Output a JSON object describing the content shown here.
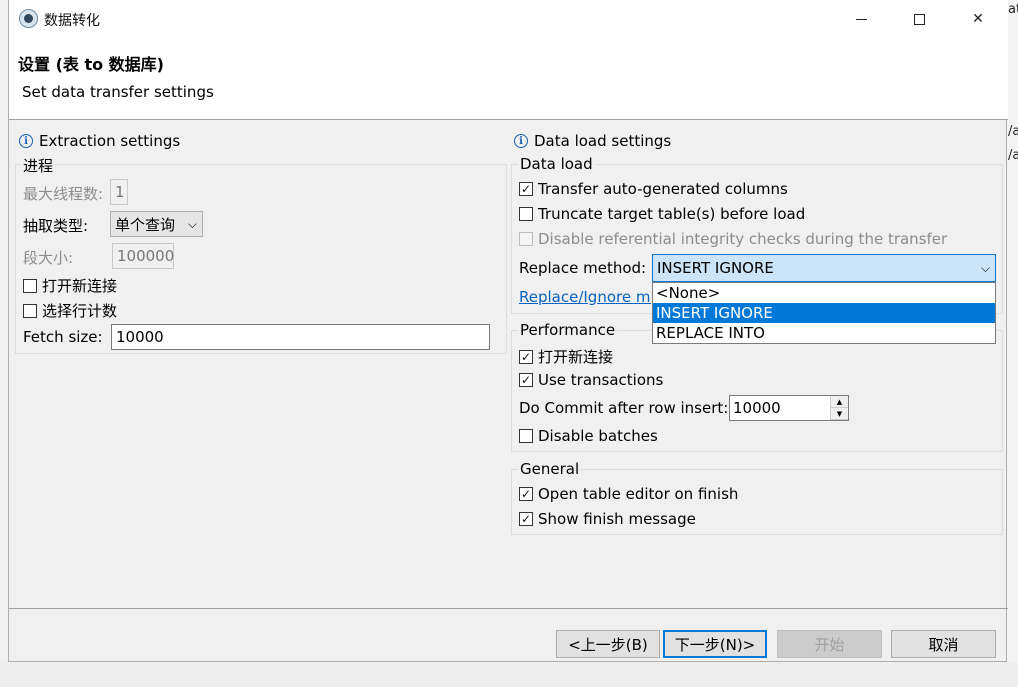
{
  "window": {
    "title": "数据转化",
    "minimize_icon": "minimize-icon",
    "maximize_icon": "maximize-icon",
    "close_glyph": "✕"
  },
  "background": {
    "right_text_1": "at",
    "right_text_2": "/a",
    "right_text_3": "/a"
  },
  "header": {
    "title": "设置 (表 to 数据库)",
    "subtitle": "Set data transfer settings"
  },
  "extraction": {
    "title": "Extraction settings",
    "group_label": "进程",
    "max_threads_label": "最大线程数:",
    "max_threads_value": "1",
    "extract_type_label": "抽取类型:",
    "extract_type_value": "单个查询",
    "segment_size_label": "段大小:",
    "segment_size_value": "100000",
    "open_new_connection": {
      "label": "打开新连接",
      "checked": false
    },
    "select_row_count": {
      "label": "选择行计数",
      "checked": false
    },
    "fetch_size_label": "Fetch size:",
    "fetch_size_value": "10000"
  },
  "data_load": {
    "title": "Data load settings",
    "group_label": "Data load",
    "transfer_auto_generated": {
      "label": "Transfer auto-generated columns",
      "checked": true
    },
    "truncate_target": {
      "label": "Truncate target table(s) before load",
      "checked": false
    },
    "disable_ref_integrity": {
      "label": "Disable referential integrity checks during the transfer",
      "checked": false
    },
    "replace_method_label": "Replace method:",
    "replace_method_value": "INSERT IGNORE",
    "replace_method_options": [
      "<None>",
      "INSERT IGNORE",
      "REPLACE INTO"
    ],
    "replace_link": "Replace/Ignore me"
  },
  "performance": {
    "group_label": "Performance",
    "open_new_connection": {
      "label": "打开新连接",
      "checked": true
    },
    "use_transactions": {
      "label": "Use transactions",
      "checked": true
    },
    "commit_label": "Do Commit after row insert:",
    "commit_value": "10000",
    "disable_batches": {
      "label": "Disable batches",
      "checked": false
    }
  },
  "general": {
    "group_label": "General",
    "open_table_editor": {
      "label": "Open table editor on finish",
      "checked": true
    },
    "show_finish_message": {
      "label": "Show finish message",
      "checked": true
    }
  },
  "buttons": {
    "back": "<上一步(B)",
    "next": "下一步(N)>",
    "start": "开始",
    "cancel": "取消"
  },
  "glyphs": {
    "check": "✓",
    "combo_arrow": "⌵",
    "spin_up": "▲",
    "spin_down": "▼",
    "info": "i"
  },
  "colors": {
    "accent": "#0078d7",
    "link": "#0563c1"
  }
}
